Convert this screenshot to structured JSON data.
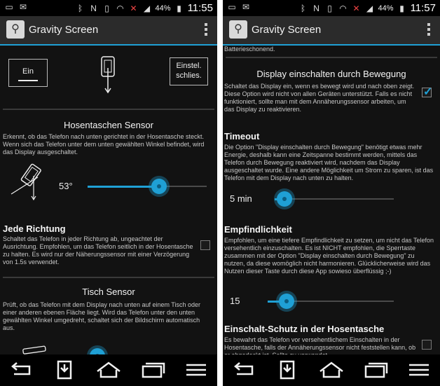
{
  "status": {
    "left_icons": [
      "screen-icon",
      "mail-icon"
    ],
    "right_icons": [
      "bluetooth-icon",
      "nfc-icon",
      "vibrate-icon",
      "wifi-icon",
      "no-sim-icon",
      "signal-icon"
    ],
    "battery": "44%"
  },
  "left": {
    "time": "11:55",
    "app_title": "Gravity Screen",
    "on_button": "Ein",
    "off_button_line1": "Einstel.",
    "off_button_line2": "schlies.",
    "pocket_sensor": {
      "title": "Hosentaschen Sensor",
      "desc": "Erkennt, ob das Telefon nach unten gerichtet in der Hosentasche steckt. Wenn sich das Telefon unter dem unten gewählten Winkel befindet, wird das Display ausgeschaltet.",
      "angle": "53°",
      "slider_fraction": 0.6
    },
    "any_direction": {
      "title": "Jede Richtung",
      "desc": "Schaltet das Telefon in jeder Richtung ab, ungeachtet der Ausrichtung. Empfohlen, um das Telefon seitlich in der Hosentasche zu halten. Es wird nur der Näherungssensor mit einer Verzögerung von 1.5s verwendet.",
      "checked": false
    },
    "table_sensor": {
      "title": "Tisch Sensor",
      "desc": "Prüft, ob das Telefon mit dem Display nach unten auf einem Tisch oder einer anderen ebenen Fläche liegt. Wird das Telefon unter den unten gewählten Winkel umgedreht, schaltet sich der Bildschirm automatisch aus."
    }
  },
  "right": {
    "time": "11:57",
    "app_title": "Gravity Screen",
    "top_fragment": "Batterieschonend.",
    "motion_on": {
      "title": "Display einschalten durch Bewegung",
      "desc": "Schaltet das Display ein, wenn es bewegt wird und nach oben zeigt. Diese Option wird nicht von allen Geräten unterstützt. Falls es nicht funktioniert, sollte man mit dem Annäherungssensor arbeiten, um das Display zu reaktivieren.",
      "checked": true
    },
    "timeout": {
      "title": "Timeout",
      "desc": "Die Option \"Display einschalten durch Bewegung\" benötigt etwas mehr Energie, deshalb kann eine Zeitspanne bestimmt werden, mittels das Telefon durch Bewegung reaktiviert wird, nachdem das Display ausgeschaltet wurde. Eine andere Möglichkeit um Strom zu sparen, ist das Telefon mit dem Display nach unten zu halten.",
      "value": "5 min",
      "slider_fraction": 0.08
    },
    "sensitivity": {
      "title": "Empfindlichkeit",
      "desc": "Empfohlen, um eine tiefere Empfindlichkeit zu setzen, um nicht das Telefon versehentlich einzuschalten. Es ist NICHT empfohlen, die Sperrtaste zusammen mit der Option \"Display einschalten durch Bewegung\" zu nutzen, da diese womöglich nicht harmonieren. Glücklicherweise wird das Nutzen dieser Taste durch diese App sowieso überflüssig ;-)",
      "value": "15",
      "slider_fraction": 0.15
    },
    "pocket_guard": {
      "title": "Einschalt-Schutz in der Hosentasche",
      "desc": "Es bewahrt das Telefon vor versehentlichem Einschalten in der Hosentasche, falls der Annäherungssensor nicht feststellen kann, ob er abgedeckt ist. Sollte zu verwendet",
      "checked": false
    }
  },
  "nav": {
    "icons": [
      "back-icon",
      "notification-icon",
      "home-icon",
      "recent-apps-icon",
      "menu-icon"
    ]
  }
}
